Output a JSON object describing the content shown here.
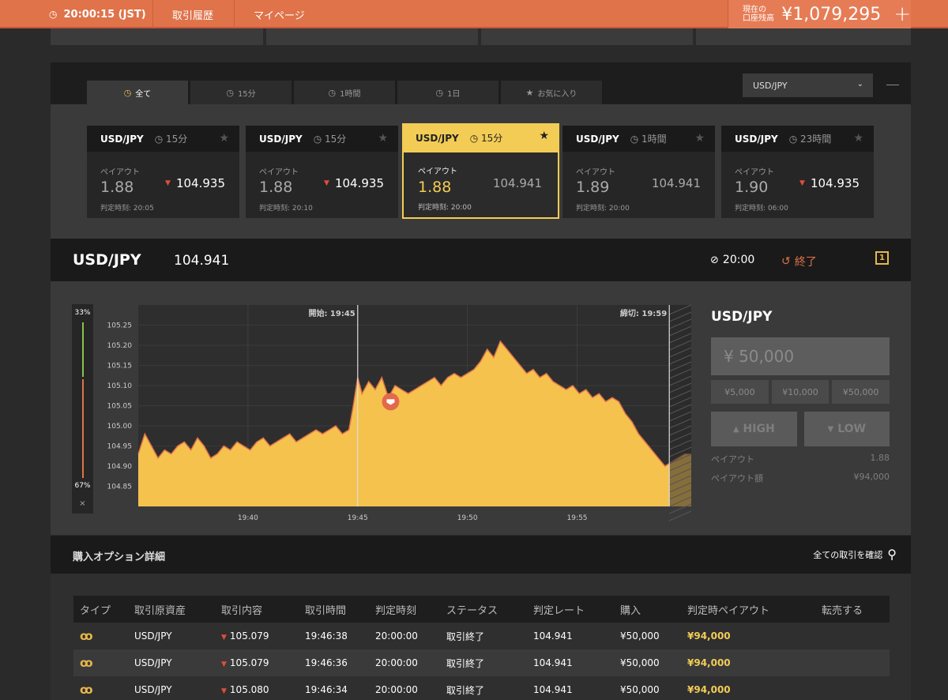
{
  "topbar": {
    "clock": "20:00:15 (JST)",
    "nav_history": "取引履歴",
    "nav_mypage": "マイページ",
    "balance_label_1": "現在の",
    "balance_label_2": "口座残高",
    "balance_amount": "¥1,079,295",
    "add_symbol": "+"
  },
  "filter_tabs": [
    {
      "label": "全て",
      "icon": "clock-icon"
    },
    {
      "label": "15分",
      "icon": "clock-icon"
    },
    {
      "label": "1時間",
      "icon": "clock-icon"
    },
    {
      "label": "1日",
      "icon": "clock-icon"
    },
    {
      "label": "お気に入り",
      "icon": "star-icon"
    }
  ],
  "pair_select": {
    "value": "USD/JPY"
  },
  "cards": [
    {
      "pair": "USD/JPY",
      "duration": "15分",
      "payout_label": "ペイアウト",
      "payout": "1.88",
      "rate": "104.935",
      "direction": "down",
      "judge": "判定時刻: 20:05"
    },
    {
      "pair": "USD/JPY",
      "duration": "15分",
      "payout_label": "ペイアウト",
      "payout": "1.88",
      "rate": "104.935",
      "direction": "down",
      "judge": "判定時刻: 20:10"
    },
    {
      "pair": "USD/JPY",
      "duration": "15分",
      "payout_label": "ペイアウト",
      "payout": "1.88",
      "rate": "104.941",
      "direction": "none",
      "judge": "判定時刻: 20:00"
    },
    {
      "pair": "USD/JPY",
      "duration": "1時間",
      "payout_label": "ペイアウト",
      "payout": "1.89",
      "rate": "104.941",
      "direction": "none",
      "judge": "判定時刻: 20:00"
    },
    {
      "pair": "USD/JPY",
      "duration": "23時間",
      "payout_label": "ペイアウト",
      "payout": "1.90",
      "rate": "104.935",
      "direction": "down",
      "judge": "判定時刻: 06:00"
    }
  ],
  "infobar": {
    "pair": "USD/JPY",
    "rate": "104.941",
    "time": "20:00",
    "ended": "終了",
    "one_click": "1"
  },
  "gauge": {
    "high_pct": "33%",
    "low_pct": "67%",
    "close": "×"
  },
  "chart_data": {
    "type": "area",
    "title": "",
    "xlabel": "",
    "ylabel": "",
    "start_label": "開始: 19:45",
    "end_label": "締切: 19:59",
    "x_ticks": [
      "19:40",
      "19:45",
      "19:50",
      "19:55"
    ],
    "y_ticks": [
      "105.25",
      "105.20",
      "105.15",
      "105.10",
      "105.05",
      "105.00",
      "104.95",
      "104.90",
      "104.85"
    ],
    "xlim_min": [
      35,
      60.2
    ],
    "ylim": [
      104.8,
      105.3
    ],
    "x": [
      35.0,
      35.3,
      35.6,
      35.9,
      36.2,
      36.5,
      36.8,
      37.1,
      37.4,
      37.7,
      38.0,
      38.3,
      38.6,
      38.9,
      39.2,
      39.5,
      39.8,
      40.1,
      40.4,
      40.7,
      41.0,
      41.3,
      41.6,
      41.9,
      42.2,
      42.5,
      42.8,
      43.1,
      43.4,
      43.7,
      44.0,
      44.3,
      44.6,
      44.8,
      45.0,
      45.2,
      45.5,
      45.8,
      46.1,
      46.4,
      46.7,
      47.0,
      47.3,
      47.6,
      47.9,
      48.2,
      48.5,
      48.8,
      49.1,
      49.4,
      49.7,
      50.0,
      50.3,
      50.6,
      50.9,
      51.2,
      51.5,
      51.8,
      52.1,
      52.4,
      52.7,
      53.0,
      53.3,
      53.6,
      53.9,
      54.2,
      54.5,
      54.8,
      55.1,
      55.4,
      55.7,
      56.0,
      56.3,
      56.6,
      56.9,
      57.2,
      57.5,
      57.8,
      58.1,
      58.4,
      58.7,
      59.0,
      59.3,
      59.6,
      59.9,
      60.2
    ],
    "values": [
      104.93,
      104.98,
      104.95,
      104.92,
      104.94,
      104.93,
      104.95,
      104.96,
      104.94,
      104.97,
      104.95,
      104.92,
      104.93,
      104.95,
      104.94,
      104.96,
      104.95,
      104.94,
      104.96,
      104.97,
      104.95,
      104.96,
      104.97,
      104.98,
      104.96,
      104.97,
      104.98,
      104.99,
      104.98,
      104.99,
      105.0,
      104.98,
      104.99,
      105.05,
      105.12,
      105.08,
      105.11,
      105.09,
      105.12,
      105.07,
      105.1,
      105.09,
      105.08,
      105.09,
      105.1,
      105.11,
      105.12,
      105.1,
      105.12,
      105.13,
      105.12,
      105.13,
      105.14,
      105.16,
      105.19,
      105.17,
      105.21,
      105.19,
      105.17,
      105.15,
      105.13,
      105.14,
      105.12,
      105.13,
      105.11,
      105.1,
      105.09,
      105.1,
      105.08,
      105.09,
      105.07,
      105.08,
      105.06,
      105.07,
      105.06,
      105.03,
      105.01,
      104.98,
      104.96,
      104.94,
      104.92,
      104.9,
      104.91,
      104.92,
      104.93,
      104.93
    ],
    "marker": {
      "x": 46.5,
      "y": 105.06,
      "direction": "down"
    },
    "colors": {
      "area": "#f5c24e",
      "line": "#e0734a",
      "bg": "#2e2e2e"
    }
  },
  "side": {
    "pair": "USD/JPY",
    "amount_placeholder": "¥ 50,000",
    "quick": [
      "¥5,000",
      "¥10,000",
      "¥50,000"
    ],
    "high": "HIGH",
    "low": "LOW",
    "payout_label": "ペイアウト",
    "payout_value": "1.88",
    "payout_amount_label": "ペイアウト額",
    "payout_amount_value": "¥94,000"
  },
  "details": {
    "heading": "購入オプション詳細",
    "all_link": "全ての取引を確認",
    "columns": [
      "タイプ",
      "取引原資産",
      "取引内容",
      "取引時間",
      "判定時刻",
      "ステータス",
      "判定レート",
      "購入",
      "判定時ペイアウト",
      "転売する"
    ],
    "rows": [
      {
        "asset": "USD/JPY",
        "content": "105.079",
        "time": "19:46:38",
        "judge": "20:00:00",
        "status": "取引終了",
        "rate": "104.941",
        "buy": "¥50,000",
        "payout": "¥94,000",
        "resell": ""
      },
      {
        "asset": "USD/JPY",
        "content": "105.079",
        "time": "19:46:36",
        "judge": "20:00:00",
        "status": "取引終了",
        "rate": "104.941",
        "buy": "¥50,000",
        "payout": "¥94,000",
        "resell": ""
      },
      {
        "asset": "USD/JPY",
        "content": "105.080",
        "time": "19:46:34",
        "judge": "20:00:00",
        "status": "取引終了",
        "rate": "104.941",
        "buy": "¥50,000",
        "payout": "¥94,000",
        "resell": ""
      }
    ]
  }
}
